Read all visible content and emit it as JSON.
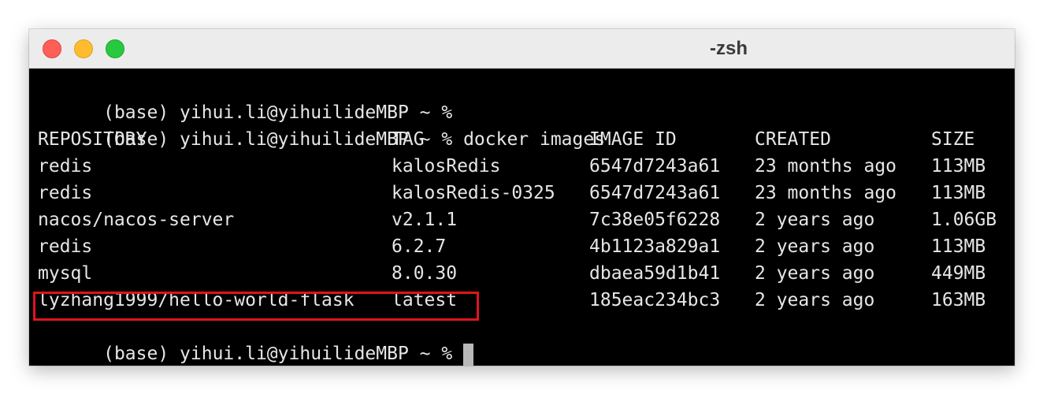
{
  "window": {
    "title": "-zsh"
  },
  "terminal": {
    "prompt": "(base) yihui.li@yihuilideMBP ~ %",
    "command": "docker images",
    "headers": [
      "REPOSITORY",
      "TAG",
      "IMAGE ID",
      "CREATED",
      "SIZE"
    ],
    "rows": [
      [
        "redis",
        "kalosRedis",
        "6547d7243a61",
        "23 months ago",
        "113MB"
      ],
      [
        "redis",
        "kalosRedis-0325",
        "6547d7243a61",
        "23 months ago",
        "113MB"
      ],
      [
        "nacos/nacos-server",
        "v2.1.1",
        "7c38e05f6228",
        "2 years ago",
        "1.06GB"
      ],
      [
        "redis",
        "6.2.7",
        "4b1123a829a1",
        "2 years ago",
        "113MB"
      ],
      [
        "mysql",
        "8.0.30",
        "dbaea59d1b41",
        "2 years ago",
        "449MB"
      ],
      [
        "lyzhang1999/hello-world-flask",
        "latest",
        "185eac234bc3",
        "2 years ago",
        "163MB"
      ]
    ],
    "highlighted_row": 5
  },
  "colors": {
    "terminal_bg": "#000000",
    "terminal_text": "#e6e6e6",
    "highlight_border": "#e0141b",
    "close": "#fe5f57",
    "minimize": "#febc2e",
    "maximize": "#28c840"
  }
}
